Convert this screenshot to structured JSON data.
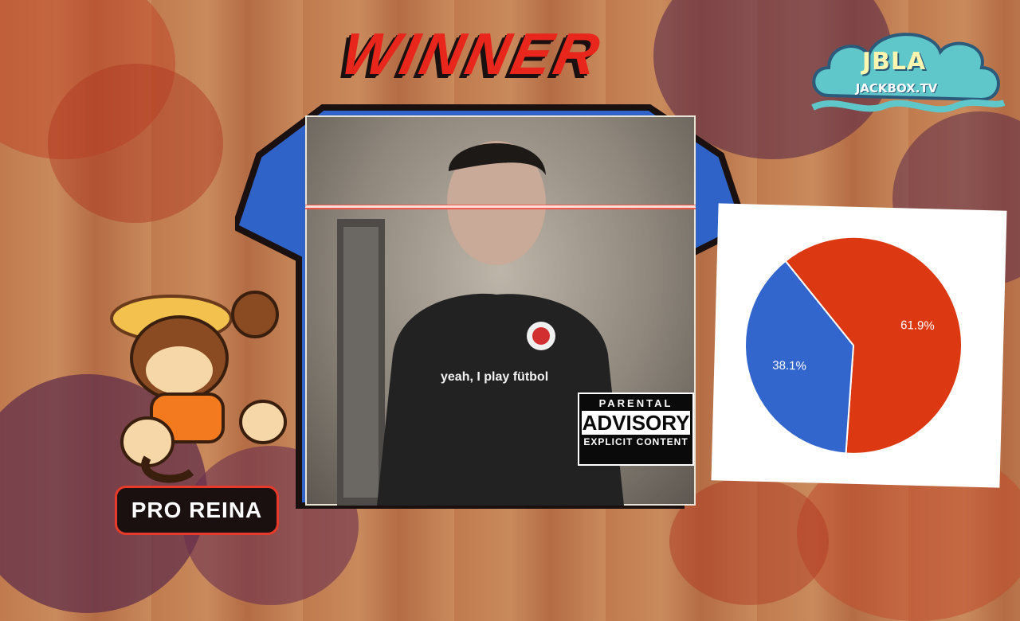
{
  "title": "WINNER",
  "logo": {
    "main": "JBLA",
    "sub": "JACKBOX.TV"
  },
  "album": {
    "caption": "yeah, I play fütbol",
    "advisory": {
      "line1": "PARENTAL",
      "line2": "ADVISORY",
      "line3": "EXPLICIT CONTENT"
    }
  },
  "player": {
    "name": "PRO REINA"
  },
  "colors": {
    "title": "#e8261b",
    "shirt": "#2f63c8",
    "pie_red": "#dc3912",
    "pie_blue": "#3366cc",
    "badge_border": "#e83a2a"
  },
  "icons": [
    "jbla-cloud-logo",
    "tanuki-avatar",
    "tshirt-graphic",
    "parental-advisory-label"
  ],
  "chart_data": {
    "type": "pie",
    "slices": [
      {
        "label": "61.9%",
        "value": 61.9,
        "color": "#dc3912"
      },
      {
        "label": "38.1%",
        "value": 38.1,
        "color": "#3366cc"
      }
    ]
  }
}
